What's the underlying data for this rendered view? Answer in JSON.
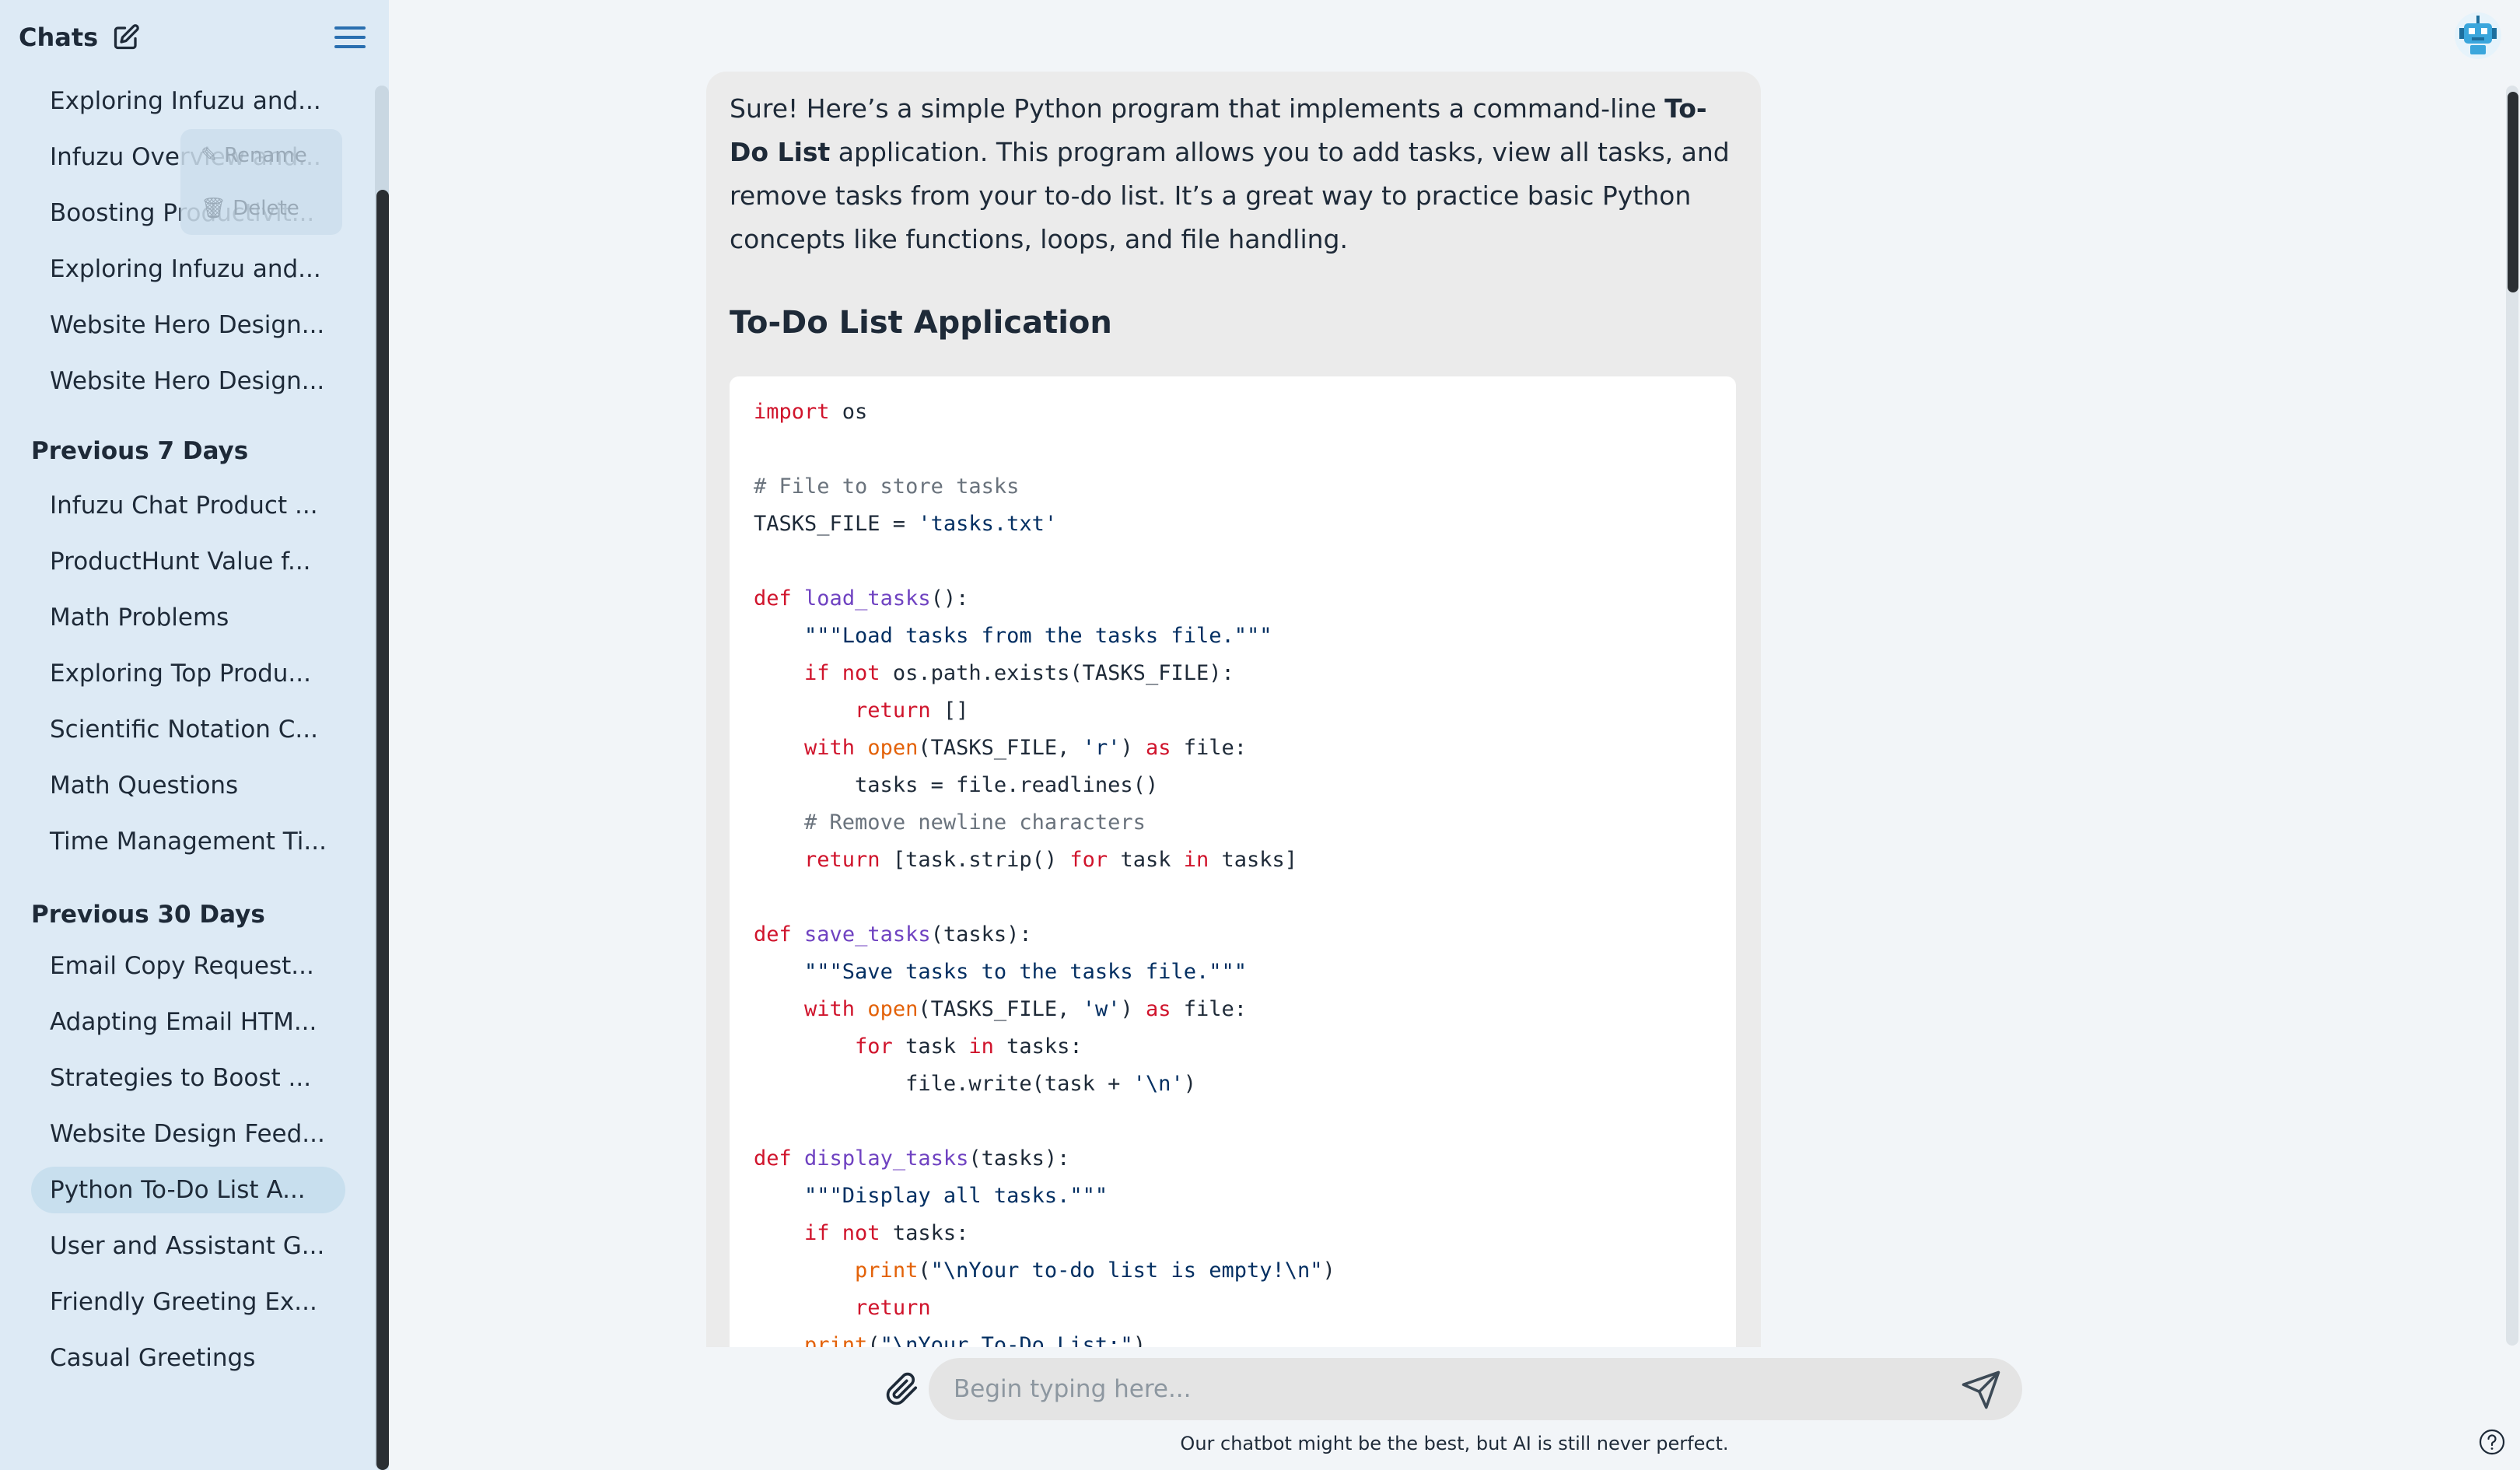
{
  "sidebar": {
    "title": "Chats",
    "today_items": [
      "Exploring Infuzu and...",
      "Infuzu Overview and...",
      "Boosting Productivit...",
      "Exploring Infuzu and...",
      "Website Hero Design...",
      "Website Hero Design..."
    ],
    "context_menu": {
      "rename": "Rename",
      "delete": "Delete"
    },
    "section_7_days": "Previous 7 Days",
    "items_7_days": [
      "Infuzu Chat Product ...",
      "ProductHunt Value f...",
      "Math Problems",
      "Exploring Top Produ...",
      "Scientific Notation C...",
      "Math Questions",
      "Time Management Ti..."
    ],
    "section_30_days": "Previous 30 Days",
    "items_30_days": [
      "Email Copy Request...",
      "Adapting Email HTM...",
      "Strategies to Boost ...",
      "Website Design Feed...",
      "Python To-Do List A...",
      "User and Assistant G...",
      "Friendly Greeting Ex...",
      "Casual Greetings"
    ],
    "active_item": "Python To-Do List A..."
  },
  "message": {
    "intro_1": "Sure! Here’s a simple Python program that implements a command-line ",
    "intro_bold": "To-Do List",
    "intro_2": " application. This program allows you to add tasks, view all tasks, and remove tasks from your to-do list. It’s a great way to practice basic Python concepts like functions, loops, and file handling.",
    "heading": "To-Do List Application",
    "code_lines": [
      [
        [
          "kw",
          "import"
        ],
        [
          "plain",
          " os"
        ]
      ],
      [],
      [
        [
          "cm",
          "# File to store tasks"
        ]
      ],
      [
        [
          "plain",
          "TASKS_FILE = "
        ],
        [
          "str",
          "'tasks.txt'"
        ]
      ],
      [],
      [
        [
          "kw",
          "def"
        ],
        [
          "plain",
          " "
        ],
        [
          "fn",
          "load_tasks"
        ],
        [
          "plain",
          "():"
        ]
      ],
      [
        [
          "plain",
          "    "
        ],
        [
          "str",
          "\"\"\"Load tasks from the tasks file.\"\"\""
        ]
      ],
      [
        [
          "plain",
          "    "
        ],
        [
          "kw",
          "if not"
        ],
        [
          "plain",
          " os.path.exists(TASKS_FILE):"
        ]
      ],
      [
        [
          "plain",
          "        "
        ],
        [
          "kw",
          "return"
        ],
        [
          "plain",
          " []"
        ]
      ],
      [
        [
          "plain",
          "    "
        ],
        [
          "kw",
          "with"
        ],
        [
          "plain",
          " "
        ],
        [
          "bi",
          "open"
        ],
        [
          "plain",
          "(TASKS_FILE, "
        ],
        [
          "str",
          "'r'"
        ],
        [
          "plain",
          ") "
        ],
        [
          "kw",
          "as"
        ],
        [
          "plain",
          " file:"
        ]
      ],
      [
        [
          "plain",
          "        tasks = file.readlines()"
        ]
      ],
      [
        [
          "plain",
          "    "
        ],
        [
          "cm",
          "# Remove newline characters"
        ]
      ],
      [
        [
          "plain",
          "    "
        ],
        [
          "kw",
          "return"
        ],
        [
          "plain",
          " [task.strip() "
        ],
        [
          "kw",
          "for"
        ],
        [
          "plain",
          " task "
        ],
        [
          "kw",
          "in"
        ],
        [
          "plain",
          " tasks]"
        ]
      ],
      [],
      [
        [
          "kw",
          "def"
        ],
        [
          "plain",
          " "
        ],
        [
          "fn",
          "save_tasks"
        ],
        [
          "plain",
          "(tasks):"
        ]
      ],
      [
        [
          "plain",
          "    "
        ],
        [
          "str",
          "\"\"\"Save tasks to the tasks file.\"\"\""
        ]
      ],
      [
        [
          "plain",
          "    "
        ],
        [
          "kw",
          "with"
        ],
        [
          "plain",
          " "
        ],
        [
          "bi",
          "open"
        ],
        [
          "plain",
          "(TASKS_FILE, "
        ],
        [
          "str",
          "'w'"
        ],
        [
          "plain",
          ") "
        ],
        [
          "kw",
          "as"
        ],
        [
          "plain",
          " file:"
        ]
      ],
      [
        [
          "plain",
          "        "
        ],
        [
          "kw",
          "for"
        ],
        [
          "plain",
          " task "
        ],
        [
          "kw",
          "in"
        ],
        [
          "plain",
          " tasks:"
        ]
      ],
      [
        [
          "plain",
          "            file.write(task + "
        ],
        [
          "str",
          "'\\n'"
        ],
        [
          "plain",
          ")"
        ]
      ],
      [],
      [
        [
          "kw",
          "def"
        ],
        [
          "plain",
          " "
        ],
        [
          "fn",
          "display_tasks"
        ],
        [
          "plain",
          "(tasks):"
        ]
      ],
      [
        [
          "plain",
          "    "
        ],
        [
          "str",
          "\"\"\"Display all tasks.\"\"\""
        ]
      ],
      [
        [
          "plain",
          "    "
        ],
        [
          "kw",
          "if not"
        ],
        [
          "plain",
          " tasks:"
        ]
      ],
      [
        [
          "plain",
          "        "
        ],
        [
          "bi",
          "print"
        ],
        [
          "plain",
          "("
        ],
        [
          "str",
          "\"\\nYour to-do list is empty!\\n\""
        ],
        [
          "plain",
          ")"
        ]
      ],
      [
        [
          "plain",
          "        "
        ],
        [
          "kw",
          "return"
        ]
      ],
      [
        [
          "plain",
          "    "
        ],
        [
          "bi",
          "print"
        ],
        [
          "plain",
          "("
        ],
        [
          "str",
          "\"\\nYour To-Do List:\""
        ],
        [
          "plain",
          ")"
        ]
      ]
    ]
  },
  "composer": {
    "placeholder": "Begin typing here...",
    "disclaimer": "Our chatbot might be the best, but AI is still never perfect."
  },
  "colors": {
    "sidebar_bg": "#ddeaf5",
    "active_item_bg": "#c8dfee",
    "main_bg": "#f2f5f8",
    "message_bg": "#ebebeb",
    "keyword": "#d0142c",
    "function": "#6f42c1",
    "builtin": "#e36209",
    "string": "#032f62",
    "comment": "#6a737d"
  },
  "icons": {
    "new_chat": "edit-icon",
    "menu": "hamburger-menu-icon",
    "avatar": "robot-avatar-icon",
    "attach": "paperclip-icon",
    "send": "send-icon",
    "help": "question-mark-icon",
    "rename": "pencil-icon",
    "delete": "trash-icon"
  }
}
